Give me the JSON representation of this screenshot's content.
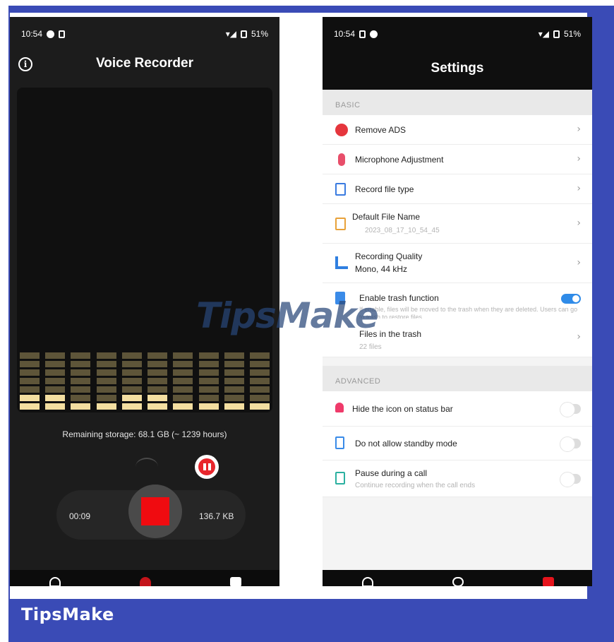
{
  "brand": "TipsMake",
  "watermark": "TipsMake",
  "left_screen": {
    "status_time": "10:54",
    "status_battery": "51%",
    "title": "Voice Recorder",
    "storage": "Remaining storage: 68.1 GB (~ 1239 hours)",
    "elapsed": "00:09",
    "file_size": "136.7 KB",
    "levels": [
      0.3,
      0.3,
      0.2,
      0.2,
      0.3,
      0.3,
      0.2,
      0.2,
      0.2,
      0.1
    ]
  },
  "right_screen": {
    "status_time": "10:54",
    "status_battery": "51%",
    "title": "Settings",
    "basic_header": "BASIC",
    "advanced_header": "ADVANCED",
    "basic_items": [
      {
        "label": "Remove ADS",
        "sub": ""
      },
      {
        "label": "Microphone Adjustment",
        "sub": ""
      },
      {
        "label": "Record file type",
        "sub": ""
      },
      {
        "label": "Default File Name",
        "sub": "2023_08_17_10_54_45"
      },
      {
        "label": "Recording Quality",
        "sub": "Mono, 44 kHz"
      },
      {
        "label": "Enable trash function",
        "sub": "If enable, files will be moved to the trash when they are deleted. Users can go to trash to restore files"
      },
      {
        "label": "Files in the trash",
        "sub": "22 files"
      }
    ],
    "advanced_items": [
      {
        "label": "Hide the icon on status bar",
        "sub": ""
      },
      {
        "label": "Do not allow standby mode",
        "sub": ""
      },
      {
        "label": "Pause during a call",
        "sub": "Continue recording when the call ends"
      }
    ],
    "trash_enabled": true
  },
  "colors": {
    "frame": "#3a4bb6",
    "record": "#f00b10",
    "toggle_on": "#2f8be8",
    "bar_active": "#f3dea0"
  }
}
